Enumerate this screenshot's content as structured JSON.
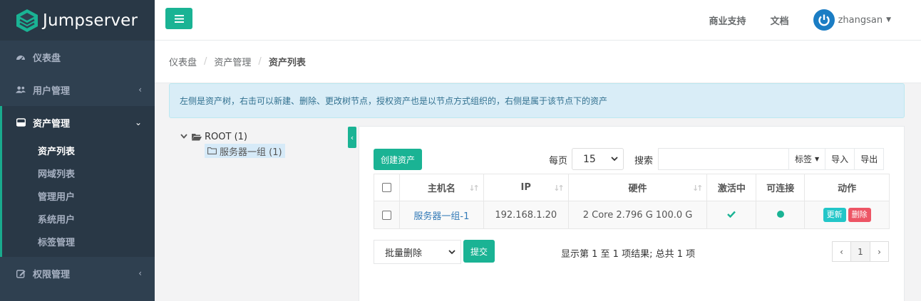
{
  "brand": {
    "name": "Jumpserver"
  },
  "sidebar": {
    "items": [
      {
        "label": "仪表盘"
      },
      {
        "label": "用户管理"
      },
      {
        "label": "资产管理",
        "sub": [
          "资产列表",
          "网域列表",
          "管理用户",
          "系统用户",
          "标签管理"
        ]
      },
      {
        "label": "权限管理"
      }
    ]
  },
  "topbar": {
    "support": "商业支持",
    "docs": "文档",
    "username": "zhangsan"
  },
  "breadcrumb": [
    "仪表盘",
    "资产管理",
    "资产列表"
  ],
  "alert": "左侧是资产树，右击可以新建、删除、更改树节点，授权资产也是以节点方式组织的，右侧是属于该节点下的资产",
  "tree": {
    "root": "ROOT (1)",
    "child": "服务器一组 (1)"
  },
  "toolbar": {
    "create": "创建资产",
    "perpage_label": "每页",
    "perpage_value": "15",
    "search_label": "搜索",
    "tag": "标签",
    "import": "导入",
    "export": "导出"
  },
  "table": {
    "headers": [
      "主机名",
      "IP",
      "硬件",
      "激活中",
      "可连接",
      "动作"
    ],
    "rows": [
      {
        "hostname": "服务器一组-1",
        "ip": "192.168.1.20",
        "hardware": "2 Core 2.796 G 100.0 G",
        "update": "更新",
        "delete": "删除"
      }
    ]
  },
  "footer": {
    "bulk_action": "批量删除",
    "submit": "提交",
    "summary": "显示第 1 至 1 项结果; 总共 1 项",
    "pager": {
      "prev": "‹",
      "current": "1",
      "next": "›"
    }
  },
  "colors": {
    "primary": "#1ab394",
    "sidebar": "#2f4050",
    "info": "#23c6c8",
    "danger": "#ed5565"
  }
}
